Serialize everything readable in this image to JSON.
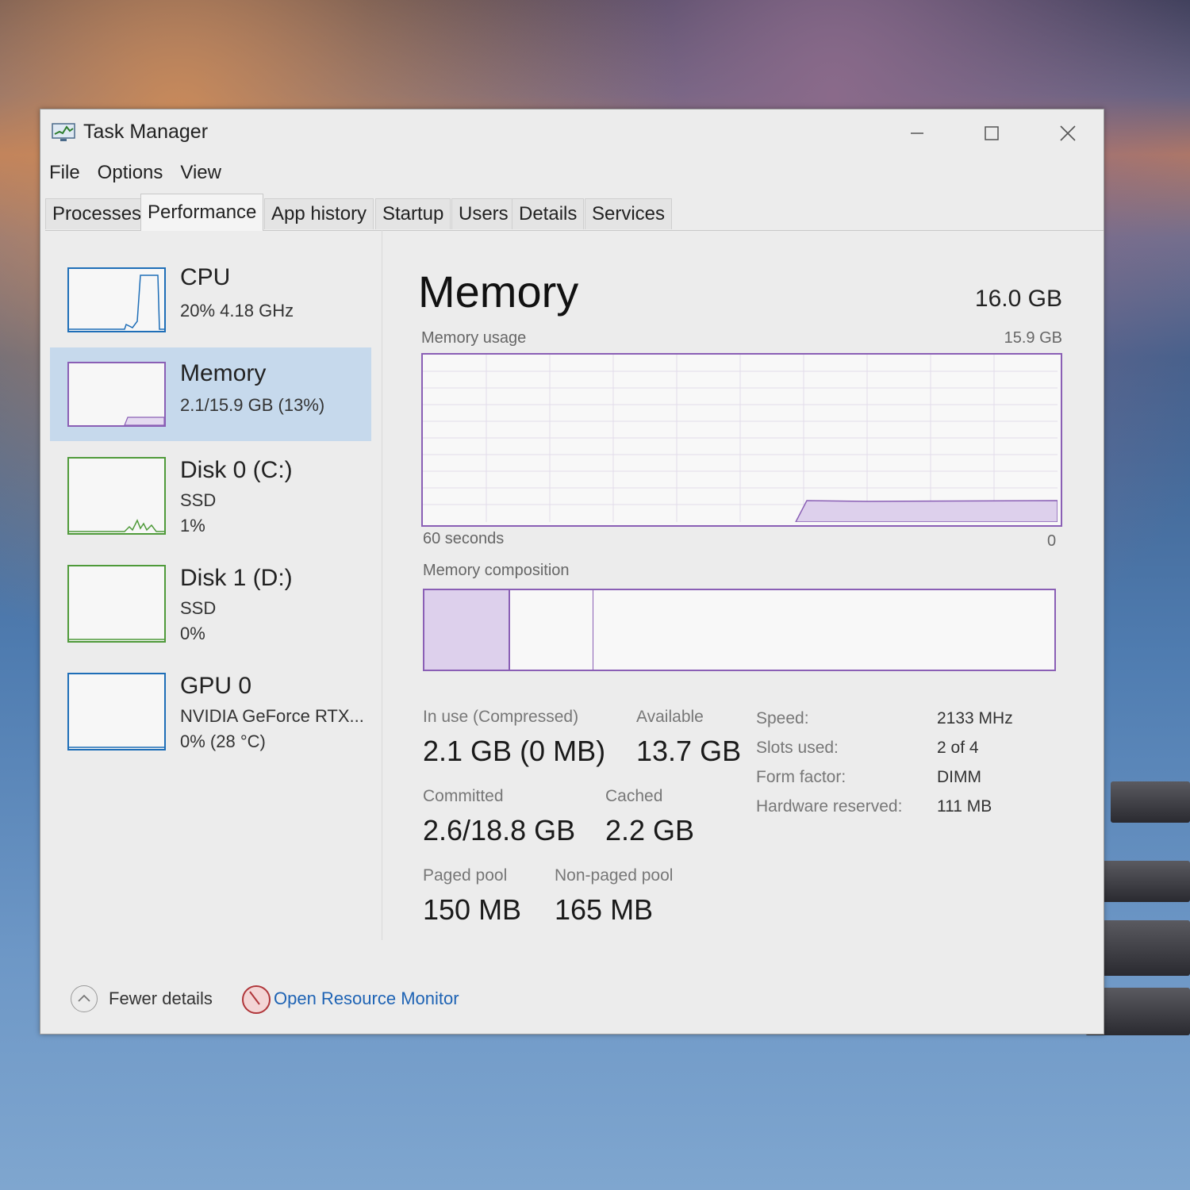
{
  "window": {
    "title": "Task Manager"
  },
  "menu": {
    "file": "File",
    "options": "Options",
    "view": "View"
  },
  "tabs": [
    "Processes",
    "Performance",
    "App history",
    "Startup",
    "Users",
    "Details",
    "Services"
  ],
  "sidebar": {
    "cpu": {
      "name": "CPU",
      "sub": "20%  4.18 GHz"
    },
    "memory": {
      "name": "Memory",
      "sub": "2.1/15.9 GB (13%)"
    },
    "disk0": {
      "name": "Disk 0 (C:)",
      "type": "SSD",
      "usage": "1%"
    },
    "disk1": {
      "name": "Disk 1 (D:)",
      "type": "SSD",
      "usage": "0%"
    },
    "gpu0": {
      "name": "GPU 0",
      "model": "NVIDIA GeForce RTX...",
      "usage": "0%  (28 °C)"
    }
  },
  "memory": {
    "title": "Memory",
    "total": "16.0 GB",
    "usage_label": "Memory usage",
    "usage_max": "15.9 GB",
    "time_left": "60 seconds",
    "time_right": "0",
    "composition_label": "Memory composition",
    "stats": {
      "in_use_label": "In use (Compressed)",
      "in_use_value": "2.1 GB (0 MB)",
      "available_label": "Available",
      "available_value": "13.7 GB",
      "committed_label": "Committed",
      "committed_value": "2.6/18.8 GB",
      "cached_label": "Cached",
      "cached_value": "2.2 GB",
      "paged_label": "Paged pool",
      "paged_value": "150 MB",
      "nonpaged_label": "Non-paged pool",
      "nonpaged_value": "165 MB"
    },
    "details": {
      "speed_label": "Speed:",
      "speed_value": "2133 MHz",
      "slots_label": "Slots used:",
      "slots_value": "2 of 4",
      "form_label": "Form factor:",
      "form_value": "DIMM",
      "reserved_label": "Hardware reserved:",
      "reserved_value": "111 MB"
    }
  },
  "footer": {
    "fewer_details": "Fewer details",
    "resource_monitor": "Open Resource Monitor"
  },
  "colors": {
    "accent_memory": "#8a5fb5",
    "selected_bg": "#c6d9ec",
    "disk_green": "#4f9a3a",
    "cpu_blue": "#1e6eb7",
    "link_blue": "#1e63b4"
  }
}
